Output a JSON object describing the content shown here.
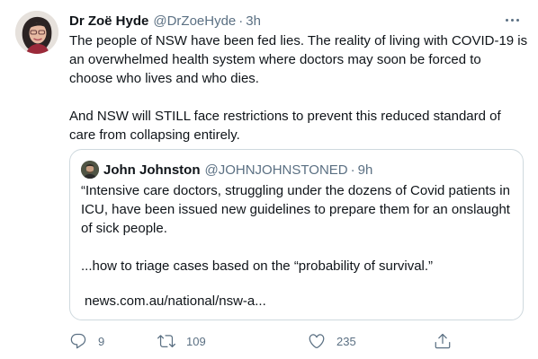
{
  "tweet": {
    "display_name": "Dr Zoë Hyde",
    "handle": "@DrZoeHyde",
    "separator": "·",
    "time": "3h",
    "paragraphs": [
      "The people of NSW have been fed lies. The reality of living with COVID-19 is an overwhelmed health system where doctors may soon be forced to choose who lives and who dies.",
      "And NSW will STILL face restrictions to prevent this reduced standard of care from collapsing entirely."
    ]
  },
  "quoted_tweet": {
    "display_name": "John Johnston",
    "handle": "@JOHNJOHNSTONED",
    "separator": "·",
    "time": "9h",
    "paragraphs": [
      "“Intensive care doctors, struggling under the dozens of Covid patients in ICU, have been issued new guidelines to prepare them for an onslaught of sick people.",
      "...how to triage cases based on the “probability of survival.”"
    ],
    "link_text": "news.com.au/national/nsw-a..."
  },
  "actions": {
    "reply": {
      "icon": "reply-icon",
      "count": "9"
    },
    "retweet": {
      "icon": "retweet-icon",
      "count": "109"
    },
    "like": {
      "icon": "heart-icon",
      "count": "235"
    },
    "share": {
      "icon": "share-icon"
    }
  },
  "colors": {
    "text": "#0f1419",
    "secondary": "#5b7083",
    "border": "#cfd9de"
  }
}
